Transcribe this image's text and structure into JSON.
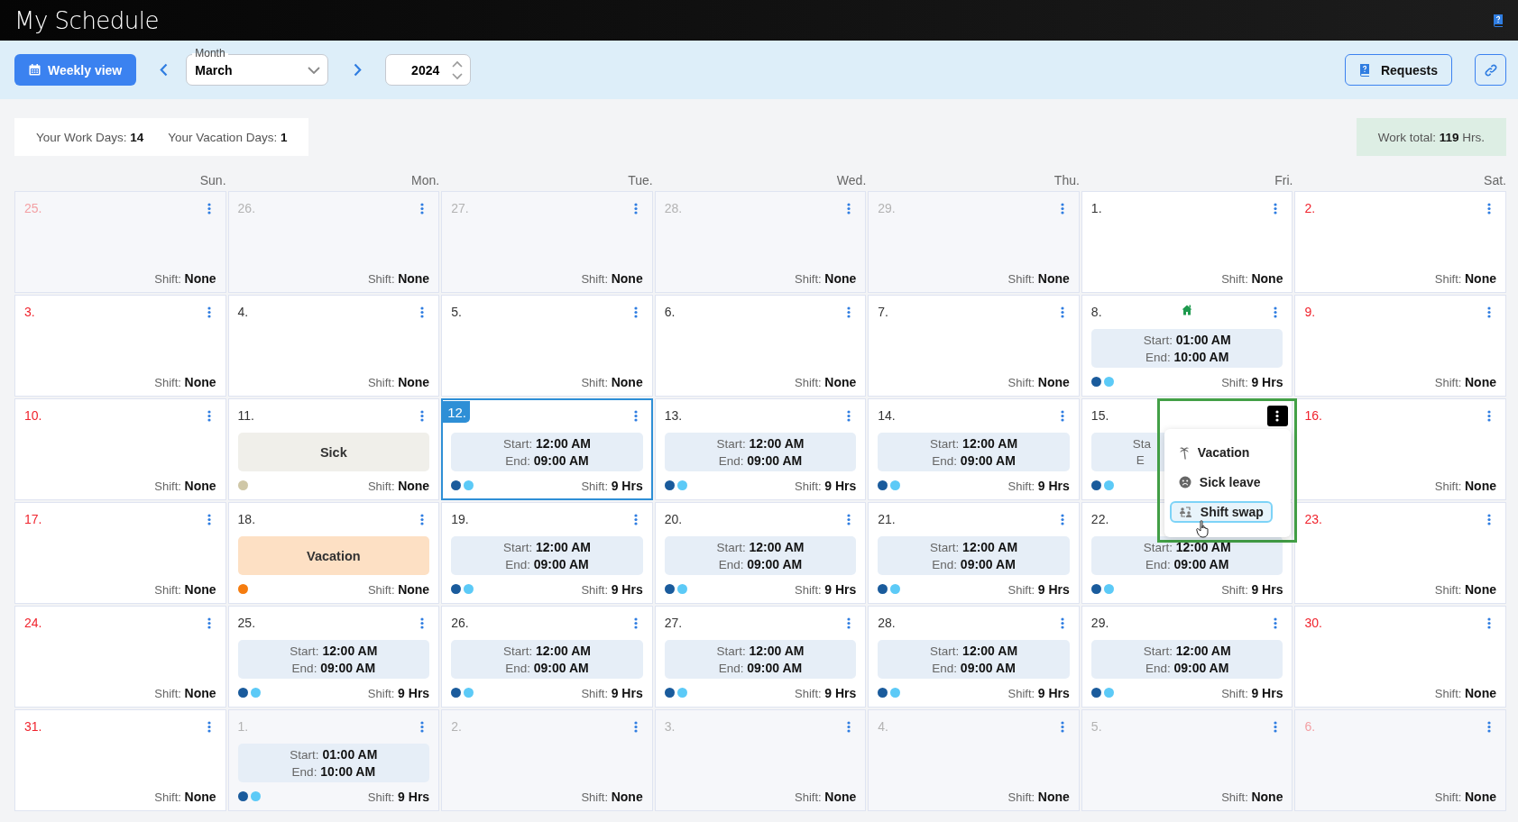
{
  "header": {
    "title": "My Schedule"
  },
  "toolbar": {
    "view_button": "Weekly view",
    "month": {
      "label": "Month",
      "value": "March"
    },
    "year": "2024",
    "requests_button": "Requests"
  },
  "summary": {
    "work_days": "Your Work Days: **14**",
    "vacation_days": "Your Vacation Days: **1**",
    "work_total": "Work total: **119** Hrs."
  },
  "weekdays": [
    "Sun.",
    "Mon.",
    "Tue.",
    "Wed.",
    "Thu.",
    "Fri.",
    "Sat."
  ],
  "cells": [
    {
      "day": "25.",
      "other_month": true,
      "weekend": true,
      "selected": false,
      "home": false,
      "menu_open": false,
      "shift": "Shift: **None**"
    },
    {
      "day": "26.",
      "other_month": true,
      "weekend": false,
      "selected": false,
      "home": false,
      "menu_open": false,
      "shift": "Shift: **None**"
    },
    {
      "day": "27.",
      "other_month": true,
      "weekend": false,
      "selected": false,
      "home": false,
      "menu_open": false,
      "shift": "Shift: **None**"
    },
    {
      "day": "28.",
      "other_month": true,
      "weekend": false,
      "selected": false,
      "home": false,
      "menu_open": false,
      "shift": "Shift: **None**"
    },
    {
      "day": "29.",
      "other_month": true,
      "weekend": false,
      "selected": false,
      "home": false,
      "menu_open": false,
      "shift": "Shift: **None**"
    },
    {
      "day": "1.",
      "other_month": false,
      "weekend": false,
      "selected": false,
      "home": false,
      "menu_open": false,
      "shift": "Shift: **None**"
    },
    {
      "day": "2.",
      "other_month": false,
      "weekend": true,
      "selected": false,
      "home": false,
      "menu_open": false,
      "shift": "Shift: **None**"
    },
    {
      "day": "3.",
      "other_month": false,
      "weekend": true,
      "selected": false,
      "home": false,
      "menu_open": false,
      "shift": "Shift: **None**"
    },
    {
      "day": "4.",
      "other_month": false,
      "weekend": false,
      "selected": false,
      "home": false,
      "menu_open": false,
      "shift": "Shift: **None**"
    },
    {
      "day": "5.",
      "other_month": false,
      "weekend": false,
      "selected": false,
      "home": false,
      "menu_open": false,
      "shift": "Shift: **None**"
    },
    {
      "day": "6.",
      "other_month": false,
      "weekend": false,
      "selected": false,
      "home": false,
      "menu_open": false,
      "shift": "Shift: **None**"
    },
    {
      "day": "7.",
      "other_month": false,
      "weekend": false,
      "selected": false,
      "home": false,
      "menu_open": false,
      "shift": "Shift: **None**"
    },
    {
      "day": "8.",
      "other_month": false,
      "weekend": false,
      "selected": false,
      "home": true,
      "menu_open": false,
      "entry": {
        "kind": "shift",
        "start": "Start: **01:00 AM**",
        "end": "End: **10:00 AM**"
      },
      "dots": [
        {
          "color": "#1a5b9c"
        },
        {
          "color": "#5ccaf7"
        }
      ],
      "shift": "Shift: **9 Hrs**"
    },
    {
      "day": "9.",
      "other_month": false,
      "weekend": true,
      "selected": false,
      "home": false,
      "menu_open": false,
      "shift": "Shift: **None**"
    },
    {
      "day": "10.",
      "other_month": false,
      "weekend": true,
      "selected": false,
      "home": false,
      "menu_open": false,
      "shift": "Shift: **None**"
    },
    {
      "day": "11.",
      "other_month": false,
      "weekend": false,
      "selected": false,
      "home": false,
      "menu_open": false,
      "entry": {
        "kind": "absence",
        "label": "Sick",
        "color": "#f0efea"
      },
      "dots": [
        {
          "color": "#cfc7a7"
        }
      ],
      "shift": "Shift: **None**"
    },
    {
      "day": "12.",
      "other_month": false,
      "weekend": false,
      "selected": true,
      "home": false,
      "menu_open": false,
      "entry": {
        "kind": "shift",
        "start": "Start: **12:00 AM**",
        "end": "End: **09:00 AM**"
      },
      "dots": [
        {
          "color": "#1a5b9c"
        },
        {
          "color": "#5ccaf7"
        }
      ],
      "shift": "Shift: **9 Hrs**"
    },
    {
      "day": "13.",
      "other_month": false,
      "weekend": false,
      "selected": false,
      "home": false,
      "menu_open": false,
      "entry": {
        "kind": "shift",
        "start": "Start: **12:00 AM**",
        "end": "End: **09:00 AM**"
      },
      "dots": [
        {
          "color": "#1a5b9c"
        },
        {
          "color": "#5ccaf7"
        }
      ],
      "shift": "Shift: **9 Hrs**"
    },
    {
      "day": "14.",
      "other_month": false,
      "weekend": false,
      "selected": false,
      "home": false,
      "menu_open": false,
      "entry": {
        "kind": "shift",
        "start": "Start: **12:00 AM**",
        "end": "End: **09:00 AM**"
      },
      "dots": [
        {
          "color": "#1a5b9c"
        },
        {
          "color": "#5ccaf7"
        }
      ],
      "shift": "Shift: **9 Hrs**"
    },
    {
      "day": "15.",
      "other_month": false,
      "weekend": false,
      "selected": false,
      "home": false,
      "menu_open": true,
      "entry": {
        "kind": "covered",
        "start": "Sta",
        "end": "E"
      },
      "dots": [
        {
          "color": "#1a5b9c"
        },
        {
          "color": "#5ccaf7"
        }
      ]
    },
    {
      "day": "16.",
      "other_month": false,
      "weekend": true,
      "selected": false,
      "home": false,
      "menu_open": false,
      "shift": "Shift: **None**"
    },
    {
      "day": "17.",
      "other_month": false,
      "weekend": true,
      "selected": false,
      "home": false,
      "menu_open": false,
      "shift": "Shift: **None**"
    },
    {
      "day": "18.",
      "other_month": false,
      "weekend": false,
      "selected": false,
      "home": false,
      "menu_open": false,
      "entry": {
        "kind": "absence",
        "label": "Vacation",
        "color": "#fde0c4"
      },
      "dots": [
        {
          "color": "#f57c0f"
        }
      ],
      "shift": "Shift: **None**"
    },
    {
      "day": "19.",
      "other_month": false,
      "weekend": false,
      "selected": false,
      "home": false,
      "menu_open": false,
      "entry": {
        "kind": "shift",
        "start": "Start: **12:00 AM**",
        "end": "End: **09:00 AM**"
      },
      "dots": [
        {
          "color": "#1a5b9c"
        },
        {
          "color": "#5ccaf7"
        }
      ],
      "shift": "Shift: **9 Hrs**"
    },
    {
      "day": "20.",
      "other_month": false,
      "weekend": false,
      "selected": false,
      "home": false,
      "menu_open": false,
      "entry": {
        "kind": "shift",
        "start": "Start: **12:00 AM**",
        "end": "End: **09:00 AM**"
      },
      "dots": [
        {
          "color": "#1a5b9c"
        },
        {
          "color": "#5ccaf7"
        }
      ],
      "shift": "Shift: **9 Hrs**"
    },
    {
      "day": "21.",
      "other_month": false,
      "weekend": false,
      "selected": false,
      "home": false,
      "menu_open": false,
      "entry": {
        "kind": "shift",
        "start": "Start: **12:00 AM**",
        "end": "End: **09:00 AM**"
      },
      "dots": [
        {
          "color": "#1a5b9c"
        },
        {
          "color": "#5ccaf7"
        }
      ],
      "shift": "Shift: **9 Hrs**"
    },
    {
      "day": "22.",
      "other_month": false,
      "weekend": false,
      "selected": false,
      "home": false,
      "menu_open": false,
      "entry": {
        "kind": "shift",
        "start": "Start: **12:00 AM**",
        "end": "End: **09:00 AM**"
      },
      "dots": [
        {
          "color": "#1a5b9c"
        },
        {
          "color": "#5ccaf7"
        }
      ],
      "shift": "Shift: **9 Hrs**"
    },
    {
      "day": "23.",
      "other_month": false,
      "weekend": true,
      "selected": false,
      "home": false,
      "menu_open": false,
      "shift": "Shift: **None**"
    },
    {
      "day": "24.",
      "other_month": false,
      "weekend": true,
      "selected": false,
      "home": false,
      "menu_open": false,
      "shift": "Shift: **None**"
    },
    {
      "day": "25.",
      "other_month": false,
      "weekend": false,
      "selected": false,
      "home": false,
      "menu_open": false,
      "entry": {
        "kind": "shift",
        "start": "Start: **12:00 AM**",
        "end": "End: **09:00 AM**"
      },
      "dots": [
        {
          "color": "#1a5b9c"
        },
        {
          "color": "#5ccaf7"
        }
      ],
      "shift": "Shift: **9 Hrs**"
    },
    {
      "day": "26.",
      "other_month": false,
      "weekend": false,
      "selected": false,
      "home": false,
      "menu_open": false,
      "entry": {
        "kind": "shift",
        "start": "Start: **12:00 AM**",
        "end": "End: **09:00 AM**"
      },
      "dots": [
        {
          "color": "#1a5b9c"
        },
        {
          "color": "#5ccaf7"
        }
      ],
      "shift": "Shift: **9 Hrs**"
    },
    {
      "day": "27.",
      "other_month": false,
      "weekend": false,
      "selected": false,
      "home": false,
      "menu_open": false,
      "entry": {
        "kind": "shift",
        "start": "Start: **12:00 AM**",
        "end": "End: **09:00 AM**"
      },
      "dots": [
        {
          "color": "#1a5b9c"
        },
        {
          "color": "#5ccaf7"
        }
      ],
      "shift": "Shift: **9 Hrs**"
    },
    {
      "day": "28.",
      "other_month": false,
      "weekend": false,
      "selected": false,
      "home": false,
      "menu_open": false,
      "entry": {
        "kind": "shift",
        "start": "Start: **12:00 AM**",
        "end": "End: **09:00 AM**"
      },
      "dots": [
        {
          "color": "#1a5b9c"
        },
        {
          "color": "#5ccaf7"
        }
      ],
      "shift": "Shift: **9 Hrs**"
    },
    {
      "day": "29.",
      "other_month": false,
      "weekend": false,
      "selected": false,
      "home": false,
      "menu_open": false,
      "entry": {
        "kind": "shift",
        "start": "Start: **12:00 AM**",
        "end": "End: **09:00 AM**"
      },
      "dots": [
        {
          "color": "#1a5b9c"
        },
        {
          "color": "#5ccaf7"
        }
      ],
      "shift": "Shift: **9 Hrs**"
    },
    {
      "day": "30.",
      "other_month": false,
      "weekend": true,
      "selected": false,
      "home": false,
      "menu_open": false,
      "shift": "Shift: **None**"
    },
    {
      "day": "31.",
      "other_month": false,
      "weekend": true,
      "selected": false,
      "home": false,
      "menu_open": false,
      "shift": "Shift: **None**"
    },
    {
      "day": "1.",
      "other_month": true,
      "weekend": false,
      "selected": false,
      "home": false,
      "menu_open": false,
      "entry": {
        "kind": "shift",
        "start": "Start: **01:00 AM**",
        "end": "End: **10:00 AM**"
      },
      "dots": [
        {
          "color": "#1a5b9c"
        },
        {
          "color": "#5ccaf7"
        }
      ],
      "shift": "Shift: **9 Hrs**"
    },
    {
      "day": "2.",
      "other_month": true,
      "weekend": false,
      "selected": false,
      "home": false,
      "menu_open": false,
      "shift": "Shift: **None**"
    },
    {
      "day": "3.",
      "other_month": true,
      "weekend": false,
      "selected": false,
      "home": false,
      "menu_open": false,
      "shift": "Shift: **None**"
    },
    {
      "day": "4.",
      "other_month": true,
      "weekend": false,
      "selected": false,
      "home": false,
      "menu_open": false,
      "shift": "Shift: **None**"
    },
    {
      "day": "5.",
      "other_month": true,
      "weekend": false,
      "selected": false,
      "home": false,
      "menu_open": false,
      "shift": "Shift: **None**"
    },
    {
      "day": "6.",
      "other_month": true,
      "weekend": true,
      "selected": false,
      "home": false,
      "menu_open": false,
      "shift": "Shift: **None**"
    }
  ],
  "context_menu": {
    "items": [
      {
        "label": "Vacation",
        "selected": false
      },
      {
        "label": "Sick leave",
        "selected": false
      },
      {
        "label": "Shift swap",
        "selected": true
      }
    ]
  }
}
